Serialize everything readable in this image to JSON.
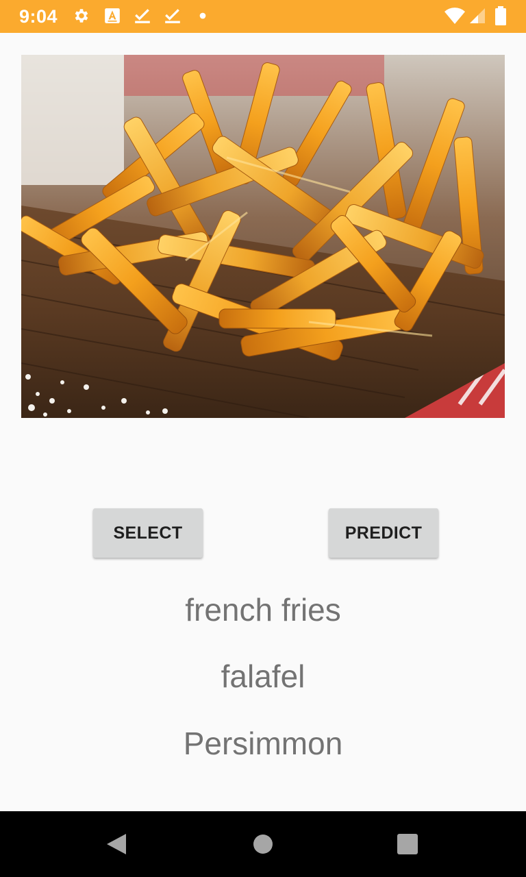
{
  "status_bar": {
    "time": "9:04",
    "background_color": "#fbaa2e",
    "left_icons": [
      "gear-icon",
      "a-box-icon",
      "download-check-icon",
      "download-check-icon",
      "dot-icon"
    ],
    "right_icons": [
      "wifi-icon",
      "cell-signal-icon",
      "battery-icon"
    ]
  },
  "image": {
    "description_icon": "french-fries-photo"
  },
  "buttons": {
    "select_label": "SELECT",
    "predict_label": "PREDICT"
  },
  "predictions": [
    "french fries",
    "falafel",
    "Persimmon"
  ],
  "nav_bar": {
    "icons": [
      "back-icon",
      "home-icon",
      "recents-icon"
    ]
  }
}
